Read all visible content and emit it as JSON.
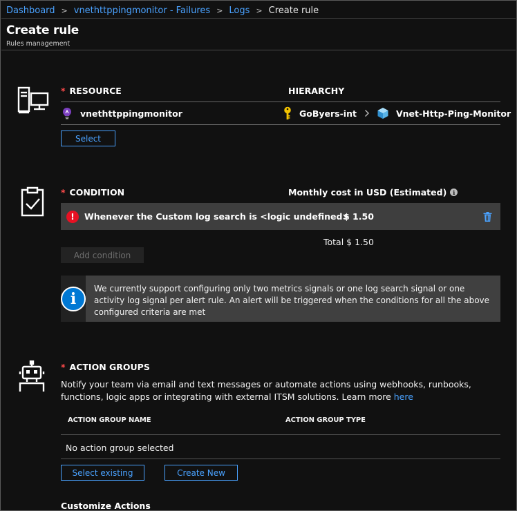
{
  "breadcrumb": {
    "items": [
      "Dashboard",
      "vnethttppingmonitor - Failures",
      "Logs"
    ],
    "current": "Create rule",
    "separator": ">"
  },
  "header": {
    "title": "Create rule",
    "subtitle": "Rules management"
  },
  "resource": {
    "required_mark": "*",
    "label": "RESOURCE",
    "hierarchy_label": "HIERARCHY",
    "name": "vnethttppingmonitor",
    "hierarchy": [
      "GoByers-int",
      "Vnet-Http-Ping-Monitor"
    ],
    "select_button": "Select",
    "icon": "server-computer-icon"
  },
  "condition": {
    "required_mark": "*",
    "label": "CONDITION",
    "cost_label": "Monthly cost in USD (Estimated)",
    "row_text": "Whenever the Custom log search is <logic undefined>",
    "row_cost": "$ 1.50",
    "total_text": "Total $ 1.50",
    "add_button": "Add condition",
    "info_text": "We currently support configuring only two metrics signals or one log search signal or one activity log signal per alert rule. An alert will be triggered when the conditions for all the above configured criteria are met",
    "icon": "clipboard-check-icon"
  },
  "action_groups": {
    "required_mark": "*",
    "label": "ACTION GROUPS",
    "description": "Notify your team via email and text messages or automate actions using webhooks, runbooks, functions, logic apps or integrating with external ITSM solutions. Learn more ",
    "learn_more_link": "here",
    "col_name": "ACTION GROUP NAME",
    "col_type": "ACTION GROUP TYPE",
    "empty_text": "No action group selected",
    "select_existing_button": "Select existing",
    "create_new_button": "Create New",
    "icon": "robot-icon"
  },
  "customize_actions_label": "Customize Actions",
  "colors": {
    "background": "#111111",
    "accent": "#4aa2ff",
    "required": "#ff4b4b",
    "error": "#e81123",
    "info": "#0078d4"
  }
}
